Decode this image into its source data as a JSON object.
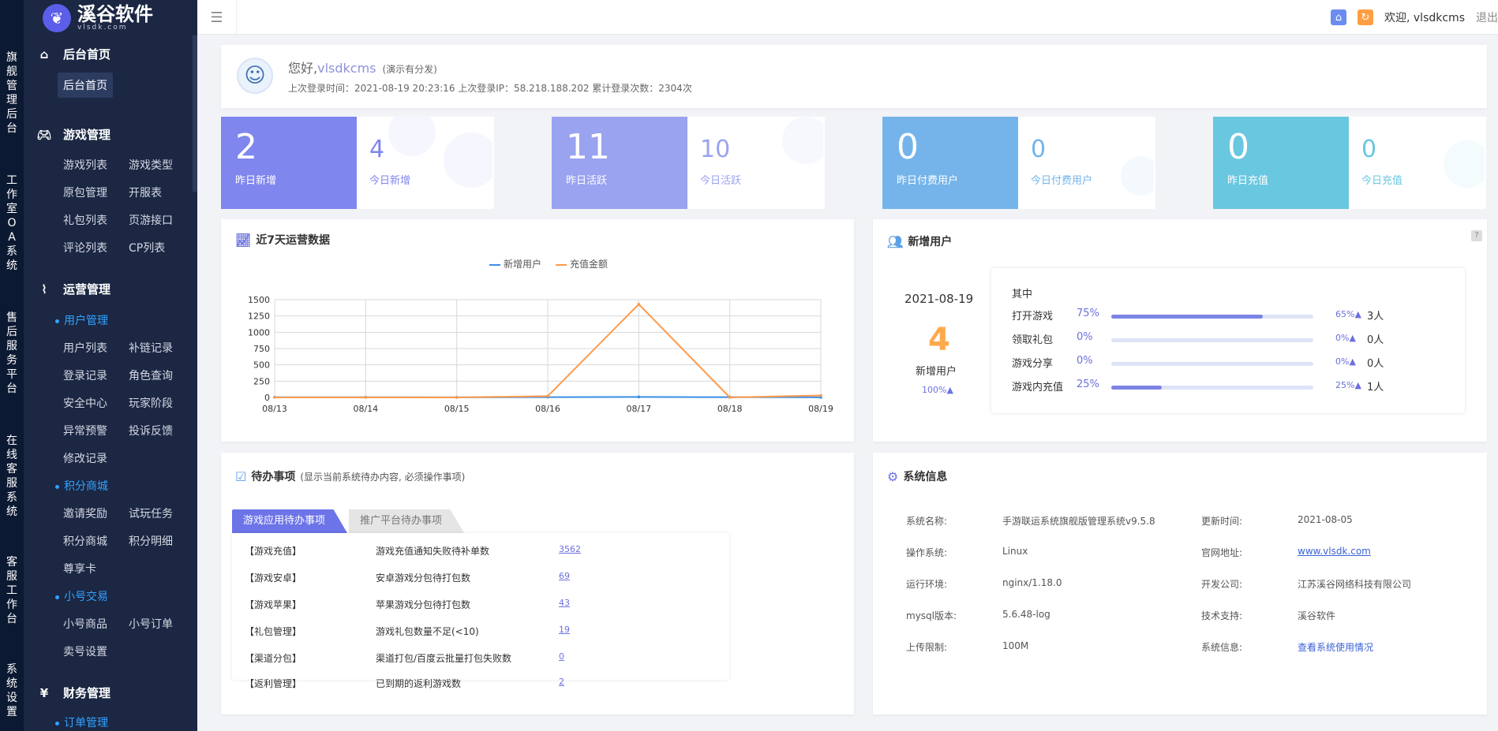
{
  "brand": {
    "name": "溪谷软件",
    "sub": "vlsdk.com"
  },
  "rail": [
    "旗舰管理后台",
    "工作室OA系统",
    "售后服务平台",
    "在线客服系统",
    "客服工作台",
    "系统设置"
  ],
  "sidebar": {
    "home": {
      "title": "后台首页",
      "item": "后台首页"
    },
    "game": {
      "title": "游戏管理",
      "items": [
        "游戏列表",
        "游戏类型",
        "原包管理",
        "开服表",
        "礼包列表",
        "页游接口",
        "评论列表",
        "CP列表"
      ]
    },
    "ops": {
      "title": "运营管理",
      "sec_user": "用户管理",
      "user_items": [
        "用户列表",
        "补链记录",
        "登录记录",
        "角色查询",
        "安全中心",
        "玩家阶段",
        "异常预警",
        "投诉反馈",
        "修改记录"
      ],
      "sec_points": "积分商城",
      "points_items": [
        "邀请奖励",
        "试玩任务",
        "积分商城",
        "积分明细",
        "尊享卡"
      ],
      "sec_trade": "小号交易",
      "trade_items": [
        "小号商品",
        "小号订单",
        "卖号设置"
      ]
    },
    "finance": {
      "title": "财务管理",
      "sec_order": "订单管理"
    }
  },
  "topbar": {
    "welcome": "欢迎, vlsdkcms",
    "logout": "退出"
  },
  "welcome": {
    "hello": "您好,",
    "name": "vlsdkcms",
    "note": "(演示有分发)",
    "last_login": "上次登录时间：2021-08-19 20:23:16 上次登录IP：58.218.188.202 累计登录次数：2304次"
  },
  "stats": [
    {
      "big": "2",
      "big_label": "昨日新增",
      "small": "4",
      "small_label": "今日新增",
      "color": "#7f86ee"
    },
    {
      "big": "11",
      "big_label": "昨日活跃",
      "small": "10",
      "small_label": "今日活跃",
      "color": "#9aa3f0"
    },
    {
      "big": "0",
      "big_label": "昨日付费用户",
      "small": "0",
      "small_label": "今日付费用户",
      "color": "#74b4ea"
    },
    {
      "big": "0",
      "big_label": "昨日充值",
      "small": "0",
      "small_label": "今日充值",
      "color": "#6ac7e0"
    }
  ],
  "chart_card": {
    "title": "近7天运营数据",
    "legend": [
      "新增用户",
      "充值金额"
    ]
  },
  "chart_data": {
    "type": "line",
    "x": [
      "08/13",
      "08/14",
      "08/15",
      "08/16",
      "08/17",
      "08/18",
      "08/19"
    ],
    "series": [
      {
        "name": "新增用户",
        "values": [
          3,
          3,
          2,
          5,
          8,
          4,
          2
        ],
        "color": "#3a8ee6"
      },
      {
        "name": "充值金额",
        "values": [
          0,
          0,
          0,
          20,
          1430,
          0,
          30
        ],
        "color": "#ff9a4a"
      }
    ],
    "yticks": [
      0,
      250,
      500,
      750,
      1000,
      1250,
      1500
    ],
    "ylim": [
      0,
      1500
    ]
  },
  "newusers": {
    "title": "新增用户",
    "date": "2021-08-19",
    "count": "4",
    "caption": "新增用户",
    "pct": "100%▲",
    "among": "其中",
    "rows": [
      {
        "name": "打开游戏",
        "pct": "75%",
        "fill": 0.75,
        "ratio": "65%▲",
        "count": "3人"
      },
      {
        "name": "领取礼包",
        "pct": "0%",
        "fill": 0,
        "ratio": "0%▲",
        "count": "0人"
      },
      {
        "name": "游戏分享",
        "pct": "0%",
        "fill": 0,
        "ratio": "0%▲",
        "count": "0人"
      },
      {
        "name": "游戏内充值",
        "pct": "25%",
        "fill": 0.25,
        "ratio": "25%▲",
        "count": "1人"
      }
    ]
  },
  "todo": {
    "title": "待办事项",
    "subtitle": "(显示当前系统待办内容, 必须操作事项)",
    "tabs": [
      "游戏应用待办事项",
      "推广平台待办事项"
    ],
    "rows": [
      [
        "【游戏充值】",
        "游戏充值通知失败待补单数",
        "3562"
      ],
      [
        "【游戏安卓】",
        "安卓游戏分包待打包数",
        "69"
      ],
      [
        "【游戏苹果】",
        "苹果游戏分包待打包数",
        "43"
      ],
      [
        "【礼包管理】",
        "游戏礼包数量不足(<10)",
        "19"
      ],
      [
        "【渠道分包】",
        "渠道打包/百度云批量打包失败数",
        "0"
      ],
      [
        "【返利管理】",
        "已到期的返利游戏数",
        "2"
      ]
    ]
  },
  "sysinfo": {
    "title": "系统信息",
    "left": [
      [
        "系统名称:",
        "手游联运系统旗舰版管理系统v9.5.8"
      ],
      [
        "操作系统:",
        "Linux"
      ],
      [
        "运行环境:",
        "nginx/1.18.0"
      ],
      [
        "mysql版本:",
        "5.6.48-log"
      ],
      [
        "上传限制:",
        "100M"
      ]
    ],
    "right": [
      [
        "更新时间:",
        "2021-08-05"
      ],
      [
        "官网地址:",
        "www.vlsdk.com"
      ],
      [
        "开发公司:",
        "江苏溪谷网络科技有限公司"
      ],
      [
        "技术支持:",
        "溪谷软件"
      ],
      [
        "系统信息:",
        "查看系统使用情况"
      ]
    ]
  }
}
